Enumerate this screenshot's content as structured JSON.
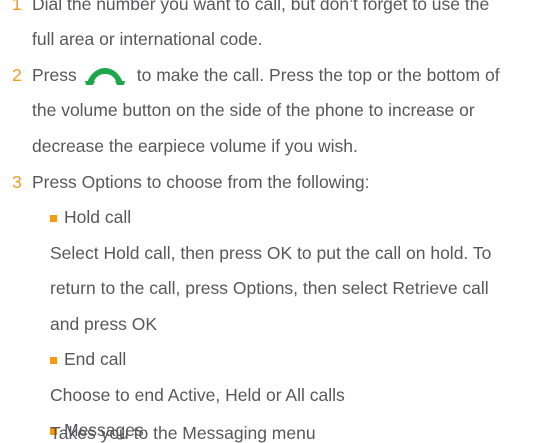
{
  "steps": [
    {
      "number": "1",
      "lines": [
        "Dial the number you want to call, but don’t forget to use the",
        "full area or international code."
      ]
    },
    {
      "number": "2",
      "line1_before_icon": "Press",
      "icon": "call-handset-icon",
      "icon_color": "#1fa64a",
      "line1_after_icon": "to make the call. Press the top or the bottom of",
      "lines": [
        "the volume button on the side of the phone to increase or",
        "decrease the earpiece volume if you wish."
      ]
    },
    {
      "number": "3",
      "lines": [
        "Press Options to choose from the following:"
      ],
      "options": [
        {
          "title": "Hold call",
          "description": [
            "Select Hold call, then press OK to put the call on hold. To",
            "return to the call, press Options, then select Retrieve call",
            "and press OK"
          ]
        },
        {
          "title": "End call",
          "description": [
            "Choose to end Active, Held or All calls"
          ]
        },
        {
          "title": "Messages",
          "description": [
            "Takes you to the Messaging menu"
          ]
        }
      ]
    }
  ],
  "colors": {
    "text": "#58585a",
    "accent": "#f39a1e",
    "call_icon": "#1fa64a"
  }
}
